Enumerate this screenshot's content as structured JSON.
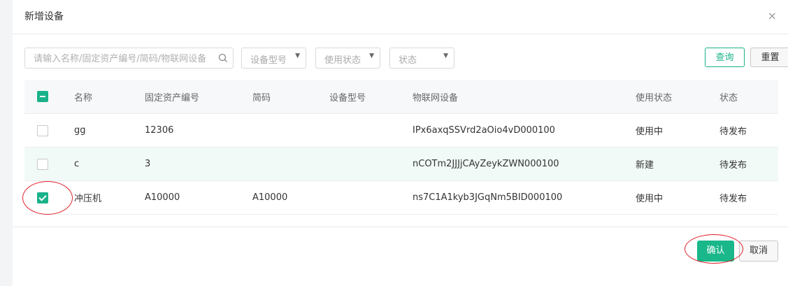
{
  "dialog": {
    "title": "新增设备",
    "close_glyph": "×"
  },
  "filters": {
    "search_placeholder": "请输入名称/固定资产编号/简码/物联网设备",
    "model_select": "设备型号",
    "usage_select": "使用状态",
    "status_select": "状态",
    "query_label": "查询",
    "reset_label": "重置"
  },
  "table": {
    "headers": [
      "名称",
      "固定资产编号",
      "简码",
      "设备型号",
      "物联网设备",
      "使用状态",
      "状态"
    ],
    "header_checkbox": "indeterminate",
    "rows": [
      {
        "checked": false,
        "name": "gg",
        "asset_no": "12306",
        "short_code": "",
        "model": "",
        "iot": "IPx6axqSSVrd2aOio4vD000100",
        "usage": "使用中",
        "status": "待发布"
      },
      {
        "checked": false,
        "name": "c",
        "asset_no": "3",
        "short_code": "",
        "model": "",
        "iot": "nCOTm2JJJjCAyZeykZWN000100",
        "usage": "新建",
        "status": "待发布"
      },
      {
        "checked": true,
        "name": "冲压机",
        "asset_no": "A10000",
        "short_code": "A10000",
        "model": "",
        "iot": "ns7C1A1kyb3JGqNm5BID000100",
        "usage": "使用中",
        "status": "待发布"
      }
    ]
  },
  "footer": {
    "confirm_label": "确认",
    "cancel_label": "取消"
  },
  "colors": {
    "accent": "#1ab28a",
    "annotation": "#e0222b",
    "highlight_row": "#f1faf7"
  }
}
